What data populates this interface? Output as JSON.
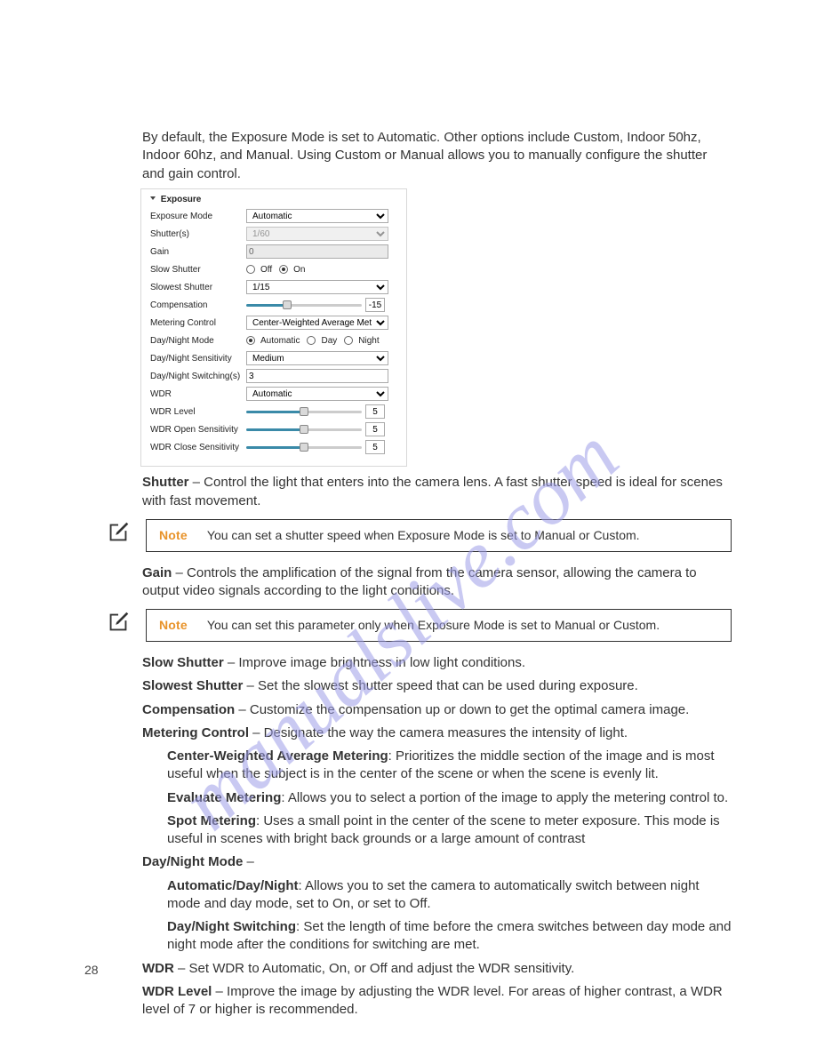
{
  "intro": "By default, the Exposure Mode is set to Automatic. Other options include Custom, Indoor 50hz, Indoor 60hz, and Manual. Using Custom or Manual allows you to manually configure the shutter and gain control.",
  "panel": {
    "legend": "Exposure",
    "rows": {
      "exposure_mode": {
        "label": "Exposure Mode",
        "value": "Automatic"
      },
      "shutter": {
        "label": "Shutter(s)",
        "value": "1/60"
      },
      "gain": {
        "label": "Gain",
        "value": "0"
      },
      "slow_shutter": {
        "label": "Slow Shutter",
        "off": "Off",
        "on": "On"
      },
      "slowest_shutter": {
        "label": "Slowest Shutter",
        "value": "1/15"
      },
      "compensation": {
        "label": "Compensation",
        "value": "-15"
      },
      "metering": {
        "label": "Metering Control",
        "value": "Center-Weighted Average Metering"
      },
      "daynight_mode": {
        "label": "Day/Night Mode",
        "auto": "Automatic",
        "day": "Day",
        "night": "Night"
      },
      "daynight_sens": {
        "label": "Day/Night Sensitivity",
        "value": "Medium"
      },
      "daynight_switch": {
        "label": "Day/Night Switching(s)",
        "value": "3"
      },
      "wdr": {
        "label": "WDR",
        "value": "Automatic"
      },
      "wdr_level": {
        "label": "WDR Level",
        "value": "5"
      },
      "wdr_open": {
        "label": "WDR Open Sensitivity",
        "value": "5"
      },
      "wdr_close": {
        "label": "WDR Close Sensitivity",
        "value": "5"
      }
    }
  },
  "defs": {
    "shutter": {
      "term": "Shutter",
      "text": " – Control the light that enters into the camera lens. A fast shutter speed is ideal for scenes with fast movement."
    },
    "gain": {
      "term": "Gain",
      "text": " – Controls the amplification of the signal from the camera sensor, allowing the camera to output video signals according to the light conditions."
    },
    "slow_shutter": {
      "term": "Slow Shutter",
      "text": " – Improve image brightness in low light conditions."
    },
    "slowest_shutter": {
      "term": "Slowest Shutter",
      "text": " – Set the slowest shutter speed that can be used during exposure."
    },
    "compensation": {
      "term": "Compensation",
      "text": " – Customize the compensation up or down to get the optimal camera image."
    },
    "metering": {
      "term": "Metering Control",
      "text": " – Designate the way the camera measures the intensity of light."
    },
    "cwam": {
      "term": "Center-Weighted Average Metering",
      "text": ": Prioritizes the middle section of the image and is most useful when the subject is in the center of the scene or when the scene is evenly lit."
    },
    "eval": {
      "term": "Evaluate Metering",
      "text": ":  Allows you to select a portion of the image to apply the metering control to."
    },
    "spot": {
      "term": "Spot Metering",
      "text": ": Uses a small point in the center of the scene to meter exposure. This mode is useful  in scenes with bright back grounds or a large amount of contrast"
    },
    "daynight": {
      "term": "Day/Night Mode",
      "text": " –"
    },
    "auto_dn": {
      "term": "Automatic/Day/Night",
      "text": ": Allows you to set the camera to automatically switch between night mode and day mode, set to On, or set to Off."
    },
    "dn_switch": {
      "term": "Day/Night Switching",
      "text": ": Set the length of time before the cmera switches between day mode and night mode after the conditions for switching are met."
    },
    "wdr": {
      "term": "WDR",
      "text": " – Set WDR to Automatic, On, or Off and adjust the WDR sensitivity."
    },
    "wdr_level": {
      "term": "WDR Level",
      "text": " – Improve the image by adjusting the WDR level. For areas of higher contrast, a WDR level of 7 or higher is recommended."
    }
  },
  "notes": {
    "label": "Note",
    "n1": "You can set a shutter speed when Exposure Mode is set to Manual or Custom.",
    "n2": "You can set this parameter only when Exposure Mode is set to Manual or Custom."
  },
  "page_number": "28",
  "watermark_text": "manualslive.com"
}
